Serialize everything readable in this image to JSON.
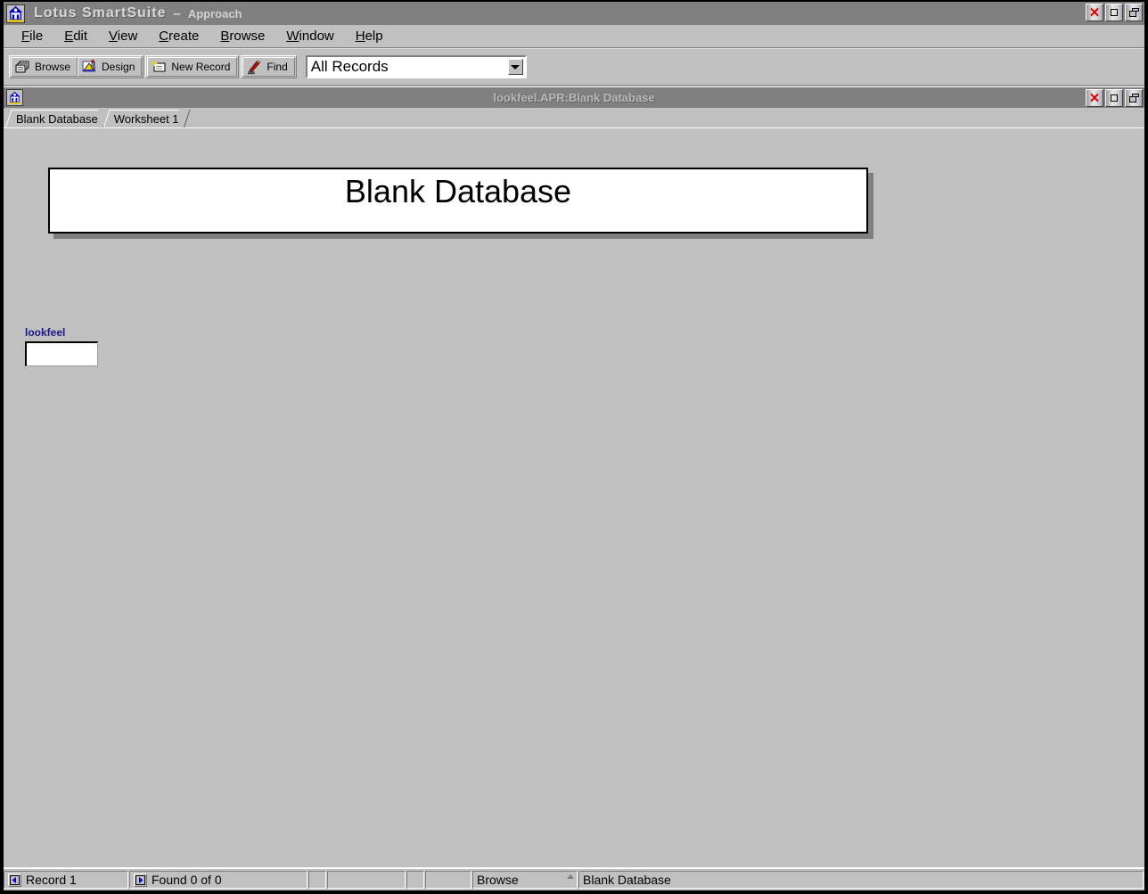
{
  "app": {
    "title_main": "Lotus SmartSuite",
    "title_dash": "–",
    "title_sub": "Approach",
    "icon": "approach-house-icon"
  },
  "window_controls": {
    "close": "✕",
    "maximize": "maximize-icon",
    "restore": "restore-icon"
  },
  "menu": {
    "items": [
      {
        "mnemonic": "F",
        "rest": "ile"
      },
      {
        "mnemonic": "E",
        "rest": "dit"
      },
      {
        "mnemonic": "V",
        "rest": "iew"
      },
      {
        "mnemonic": "C",
        "rest": "reate"
      },
      {
        "mnemonic": "B",
        "rest": "rowse"
      },
      {
        "mnemonic": "W",
        "rest": "indow"
      },
      {
        "mnemonic": "H",
        "rest": "elp"
      }
    ]
  },
  "toolbar": {
    "buttons": [
      {
        "label": "Browse",
        "icon": "browse-cards-icon"
      },
      {
        "label": "Design",
        "icon": "design-drafting-icon"
      },
      {
        "label": "New Record",
        "icon": "new-record-icon"
      },
      {
        "label": "Find",
        "icon": "find-magnifier-icon"
      }
    ],
    "find_combo": {
      "value": "All Records",
      "dropdown_icon": "chevron-down-icon"
    }
  },
  "document_window": {
    "title": "lookfeel.APR:Blank Database",
    "icon": "approach-document-icon"
  },
  "tabs": [
    {
      "label": "Blank Database",
      "active": true
    },
    {
      "label": "Worksheet 1",
      "active": false
    }
  ],
  "canvas": {
    "header_panel": {
      "text": "Blank Database"
    },
    "field": {
      "label": "lookfeel",
      "value": "",
      "placeholder": ""
    }
  },
  "status_bar": {
    "record": {
      "icon": "prev-record-icon",
      "label": "Record 1"
    },
    "found": {
      "icon": "next-record-icon",
      "label": "Found 0 of 0"
    },
    "blank_1": "",
    "blank_2": "",
    "blank_3": "",
    "blank_4": "",
    "mode": "Browse",
    "view": "Blank Database"
  },
  "colors": {
    "face": "#c0c0c0",
    "titlebar_inactive": "#808080",
    "field_label": "#1a1a8c",
    "close_red": "#e00000",
    "shadow": "#7f7f7f"
  }
}
